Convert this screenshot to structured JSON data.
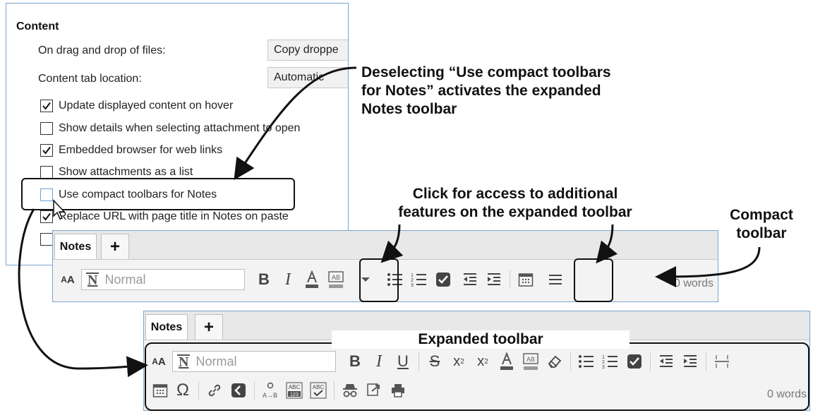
{
  "settings": {
    "section_title": "Content",
    "drag_drop_label": "On drag and drop of files:",
    "drag_drop_value": "Copy droppe",
    "tab_location_label": "Content tab location:",
    "tab_location_value": "Automatic",
    "checkboxes": [
      {
        "label": "Update displayed content on hover",
        "checked": true
      },
      {
        "label": "Show details when selecting attachment to open",
        "checked": false
      },
      {
        "label": "Embedded browser for web links",
        "checked": true
      },
      {
        "label": "Show attachments as a list",
        "checked": false
      },
      {
        "label": "Use compact toolbars for Notes",
        "checked": false
      },
      {
        "label": "Replace URL with page title in Notes on paste",
        "checked": true
      },
      {
        "label": "",
        "checked": false
      }
    ]
  },
  "compact_toolbar": {
    "tab_label": "Notes",
    "add_tab": "+",
    "style_value": "Normal",
    "words": "0 words"
  },
  "expanded_toolbar": {
    "tab_label": "Notes",
    "add_tab": "+",
    "style_value": "Normal",
    "words": "0 words"
  },
  "annotations": {
    "deselecting_line1": "Deselecting “Use compact toolbars",
    "deselecting_line2": "for Notes” activates the expanded",
    "deselecting_line3": "Notes toolbar",
    "click_line1": "Click for access to additional",
    "click_line2": "features on the expanded toolbar",
    "compact_line1": "Compact",
    "compact_line2": "toolbar",
    "expanded_label": "Expanded toolbar"
  },
  "colors": {
    "window_border": "#7aa6cf",
    "annotation_text": "#111111",
    "checkbox_blue": "#6f9ed8"
  }
}
